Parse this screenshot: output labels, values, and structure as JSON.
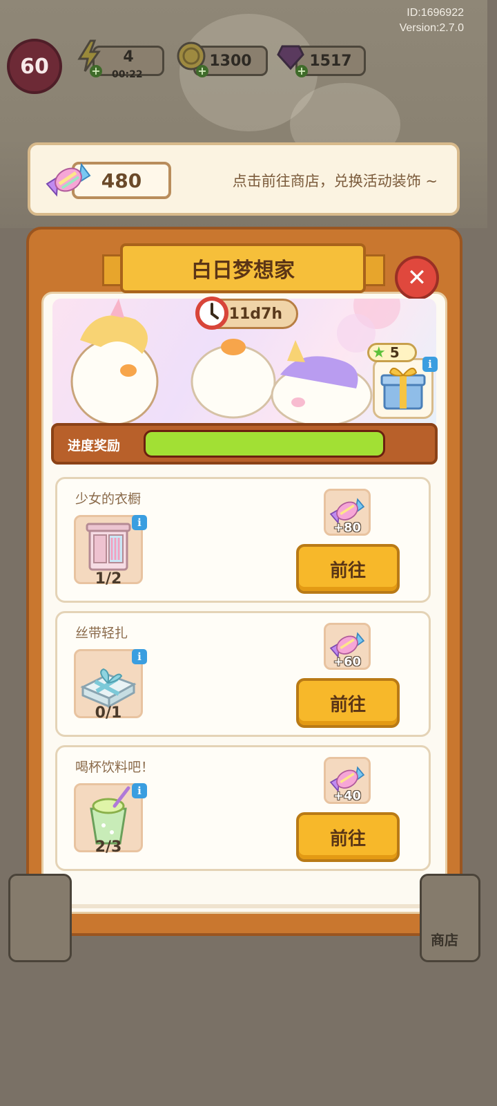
{
  "app": {
    "player_id": "ID:1696922",
    "version": "Version:2.7.0"
  },
  "resources": {
    "level": "60",
    "energy": "4",
    "energy_timer": "00:22",
    "coins": "1300",
    "gems": "1517"
  },
  "candy_banner": {
    "candy_count": "480",
    "hint": "点击前往商店，兑换活动装饰 ~"
  },
  "event": {
    "title": "白日梦想家",
    "time_left": "11d7h",
    "reward_stars": "5",
    "progress_label": "进度奖励",
    "progress_fraction": 1.0
  },
  "tasks": [
    {
      "title": "少女的衣橱",
      "progress": "1/2",
      "reward": "+80",
      "button": "前往",
      "item_icon": "wardrobe-icon"
    },
    {
      "title": "丝带轻扎",
      "progress": "0/1",
      "reward": "+60",
      "button": "前往",
      "item_icon": "ribbon-box-icon"
    },
    {
      "title": "喝杯饮料吧！",
      "progress": "2/3",
      "reward": "+40",
      "button": "前往",
      "item_icon": "drink-icon"
    }
  ],
  "bottom_bar": {
    "shop_label": "商店"
  },
  "colors": {
    "panel": "#c9772f",
    "ribbon": "#f6bf3a",
    "go_button": "#f7b82a",
    "progress_fill": "#a2e034",
    "close_button": "#e0483d"
  }
}
